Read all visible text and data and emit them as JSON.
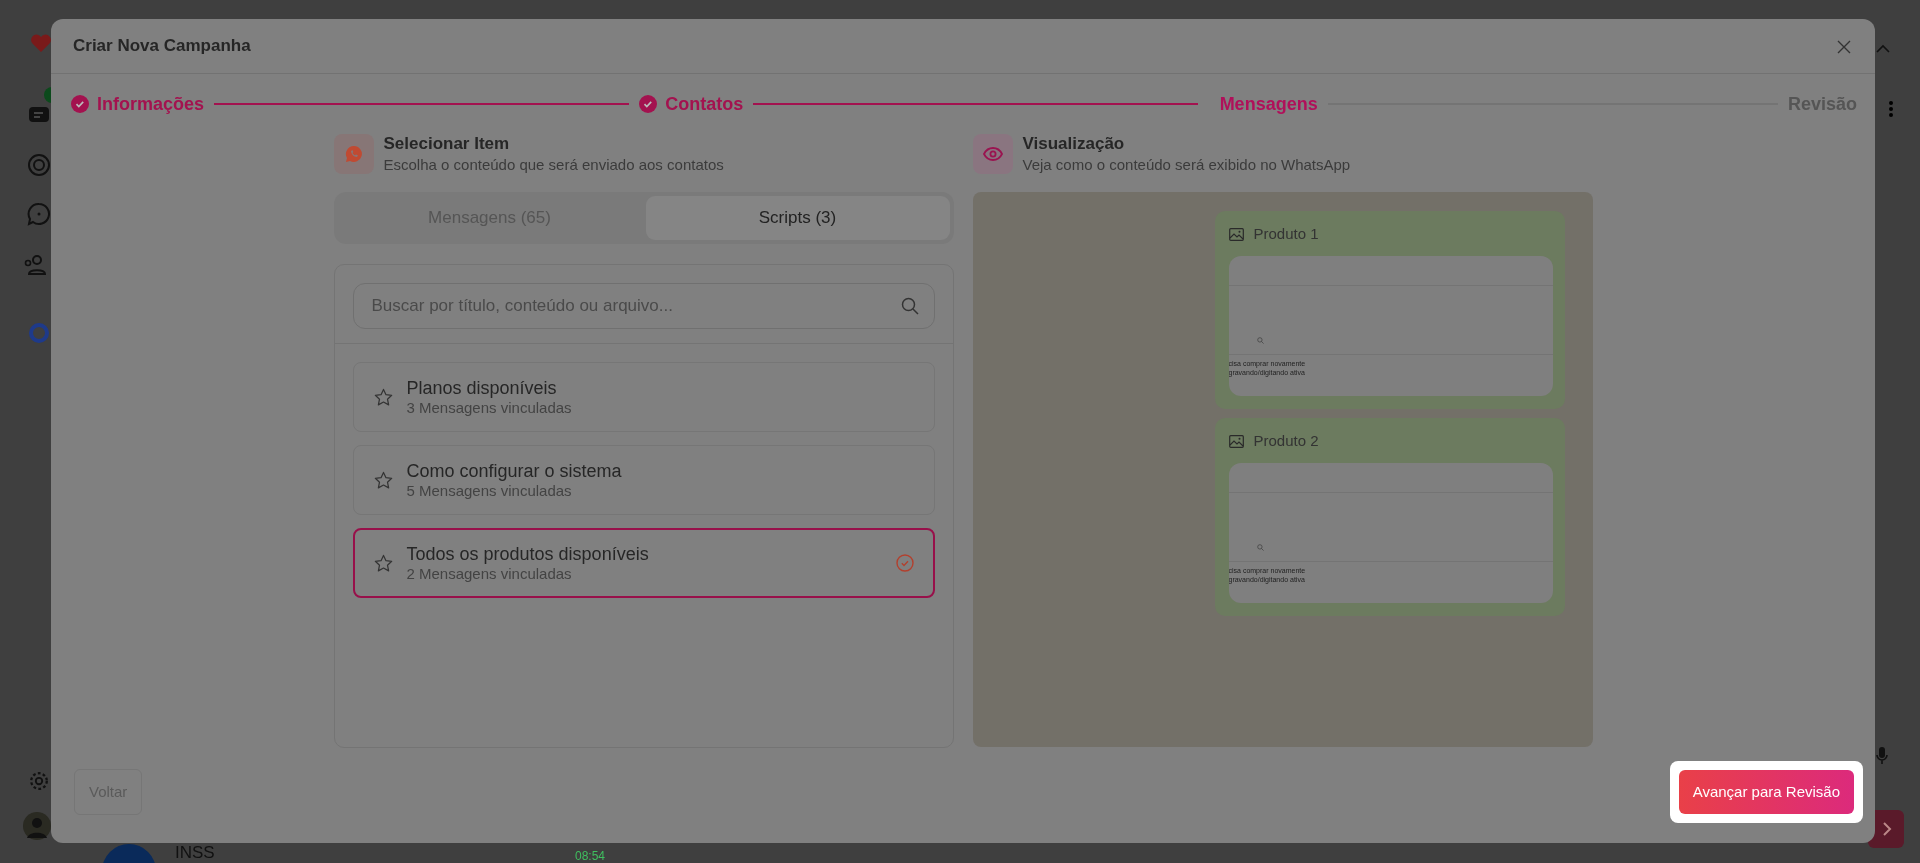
{
  "background_app": {
    "list_name": "INSS",
    "list_time": "08:54"
  },
  "modal": {
    "title": "Criar Nova Campanha",
    "steps": [
      {
        "label": "Informações",
        "completed": true,
        "selected": false
      },
      {
        "label": "Contatos",
        "completed": true,
        "selected": false
      },
      {
        "label": "Mensagens",
        "completed": false,
        "selected": true
      },
      {
        "label": "Revisão",
        "completed": false,
        "selected": false
      }
    ],
    "select_section": {
      "title": "Selecionar Item",
      "subtitle": "Escolha o conteúdo que será enviado aos contatos"
    },
    "tabs": [
      {
        "label": "Mensagens (65)",
        "selected": false
      },
      {
        "label": "Scripts (3)",
        "selected": true
      }
    ],
    "search": {
      "placeholder": "Buscar por título, conteúdo ou arquivo..."
    },
    "scripts": [
      {
        "title": "Planos disponíveis",
        "count": "3 Mensagens vinculadas",
        "selected": false
      },
      {
        "title": "Como configurar o sistema",
        "count": "5 Mensagens vinculadas",
        "selected": false
      },
      {
        "title": "Todos os produtos disponíveis",
        "count": "2 Mensagens vinculadas",
        "selected": true
      }
    ],
    "preview": {
      "title": "Visualização",
      "subtitle": "Veja como o conteúdo será exibido no WhatsApp",
      "messages": [
        {
          "caption": "Produto 1",
          "image_line": "cisa comprar novamente",
          "image_subline": "gravando/digitando ativa"
        },
        {
          "caption": "Produto 2",
          "image_line": "cisa comprar novamente",
          "image_subline": "gravando/digitando ativa"
        }
      ]
    },
    "footer": {
      "back": "Voltar",
      "next": "Avançar para Revisão"
    }
  }
}
